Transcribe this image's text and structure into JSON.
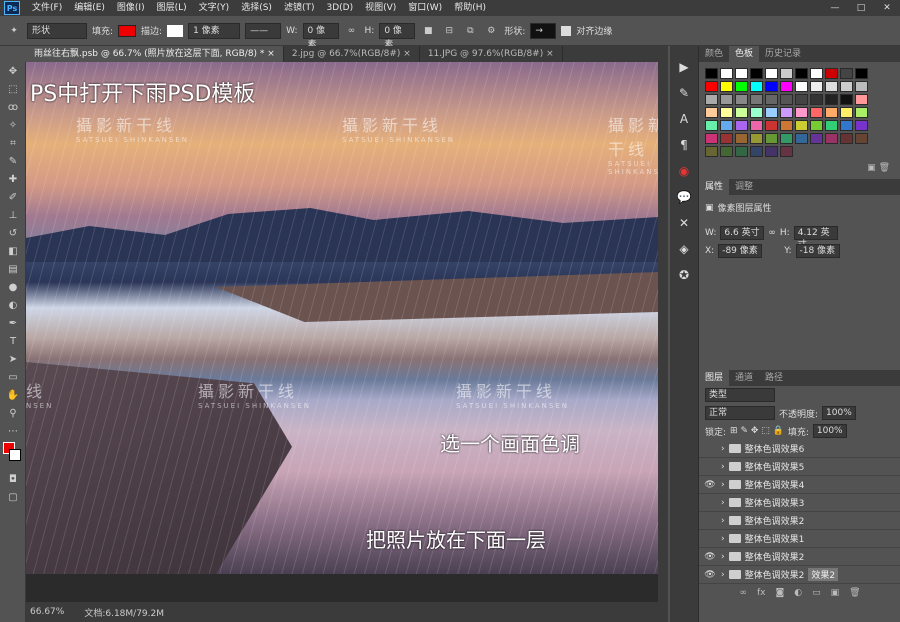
{
  "menubar": {
    "logo": "Ps",
    "items": [
      "文件(F)",
      "编辑(E)",
      "图像(I)",
      "图层(L)",
      "文字(Y)",
      "选择(S)",
      "滤镜(T)",
      "3D(D)",
      "视图(V)",
      "窗口(W)",
      "帮助(H)"
    ],
    "min": "—",
    "max": "□",
    "close": "✕"
  },
  "options": {
    "shape_mode": "形状",
    "fill_label": "填充:",
    "fill_color": "#e00000",
    "stroke_label": "描边:",
    "stroke_width": "1 像素",
    "w_label": "W:",
    "w_value": "0 像素",
    "h_label": "H:",
    "h_value": "0 像素",
    "shape_label": "形状:",
    "align_edges": "对齐边缘"
  },
  "tabs": [
    "雨丝往右飘.psb @ 66.7% (照片放在这层下面, RGB/8) *",
    "2.jpg @ 66.7%(RGB/8#)",
    "11.JPG @ 97.6%(RGB/8#)"
  ],
  "tab_close": "×",
  "canvas": {
    "title": "PS中打开下雨PSD模板",
    "caption1": "选一个画面色调",
    "caption2": "把照片放在下面一层",
    "watermark": "攝影新干线",
    "watermark_sub": "SATSUEI SHINKANSEN",
    "watermark_side_a": "线",
    "watermark_side_b": "NSEN"
  },
  "status": {
    "zoom": "66.67%",
    "doc": "文档:6.18M/79.2M"
  },
  "swatches_panel": {
    "tabs": [
      "颜色",
      "色板",
      "历史记录"
    ],
    "colors": [
      "#000000",
      "#ffffff",
      "#ffffff",
      "#000000",
      "#ffffff",
      "#cccccc",
      "#000000",
      "#ffffff",
      "#cc0000",
      "#444444",
      "#000000",
      "#ff0000",
      "#ffff00",
      "#00ff00",
      "#00ffff",
      "#0000ff",
      "#ff00ff",
      "#ffffff",
      "#eeeeee",
      "#dddddd",
      "#cccccc",
      "#bbbbbb",
      "#aaaaaa",
      "#999999",
      "#888888",
      "#777777",
      "#666666",
      "#555555",
      "#444444",
      "#333333",
      "#222222",
      "#111111",
      "#ff9999",
      "#ffcc99",
      "#ffff99",
      "#ccff99",
      "#99ffcc",
      "#99ccff",
      "#cc99ff",
      "#ff99cc",
      "#ff6666",
      "#ffaa66",
      "#ffee66",
      "#aaee66",
      "#66eeaa",
      "#66aaee",
      "#aa66ee",
      "#ee66aa",
      "#cc3333",
      "#cc7733",
      "#cccc33",
      "#77cc33",
      "#33cc77",
      "#3377cc",
      "#7733cc",
      "#cc3377",
      "#993333",
      "#996633",
      "#999933",
      "#669933",
      "#339966",
      "#336699",
      "#663399",
      "#993366",
      "#663333",
      "#664433",
      "#666633",
      "#446633",
      "#336644",
      "#334466",
      "#443366",
      "#663344"
    ]
  },
  "properties": {
    "tabs": [
      "属性",
      "调整"
    ],
    "title": "像素图层属性",
    "w_label": "W:",
    "w": "6.6 英寸",
    "h_label": "H:",
    "h": "4.12 英寸",
    "x_label": "X:",
    "x": "-89 像素",
    "y_label": "Y:",
    "y": "-18 像素"
  },
  "layers": {
    "tabs": [
      "图层",
      "通道",
      "路径"
    ],
    "filter": "类型",
    "blend": "正常",
    "opacity_label": "不透明度:",
    "opacity": "100%",
    "lock_label": "锁定:",
    "fill_label": "填充:",
    "fill": "100%",
    "rows": [
      {
        "name": "整体色调效果6",
        "visible": false
      },
      {
        "name": "整体色调效果5",
        "visible": false
      },
      {
        "name": "整体色调效果4",
        "visible": true
      },
      {
        "name": "整体色调效果3",
        "visible": false
      },
      {
        "name": "整体色调效果2",
        "visible": false
      },
      {
        "name": "整体色调效果1",
        "visible": false
      },
      {
        "name": "整体色调效果2",
        "visible": true
      },
      {
        "name": "整体色调效果2",
        "visible": true
      }
    ],
    "last_badge": "效果2",
    "footer_fx": "fx"
  }
}
